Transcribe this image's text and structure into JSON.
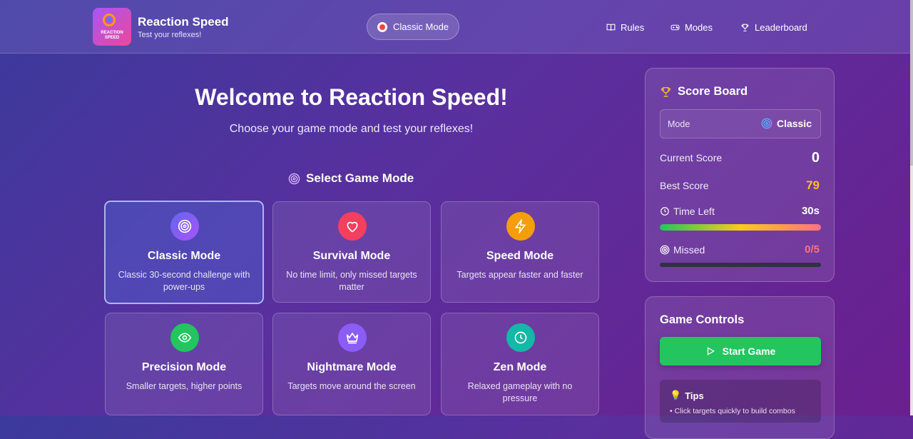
{
  "header": {
    "logo_text_line1": "REACTION",
    "logo_text_line2": "SPEED",
    "title": "Reaction Speed",
    "subtitle": "Test your reflexes!",
    "mode_pill": "Classic Mode",
    "nav": [
      {
        "label": "Rules",
        "icon": "book-icon"
      },
      {
        "label": "Modes",
        "icon": "gamepad-icon"
      },
      {
        "label": "Leaderboard",
        "icon": "trophy-icon"
      }
    ]
  },
  "main": {
    "welcome": "Welcome to Reaction Speed!",
    "subtitle": "Choose your game mode and test your reflexes!",
    "select_title": "Select Game Mode",
    "modes": [
      {
        "title": "Classic Mode",
        "desc": "Classic 30-second challenge with power-ups",
        "icon": "target-icon",
        "color": "#6366f1",
        "selected": true
      },
      {
        "title": "Survival Mode",
        "desc": "No time limit, only missed targets matter",
        "icon": "heart-icon",
        "color": "#f43f5e",
        "selected": false
      },
      {
        "title": "Speed Mode",
        "desc": "Targets appear faster and faster",
        "icon": "lightning-icon",
        "color": "#f59e0b",
        "selected": false
      },
      {
        "title": "Precision Mode",
        "desc": "Smaller targets, higher points",
        "icon": "eye-icon",
        "color": "#22c55e",
        "selected": false
      },
      {
        "title": "Nightmare Mode",
        "desc": "Targets move around the screen",
        "icon": "crown-icon",
        "color": "#8b5cf6",
        "selected": false
      },
      {
        "title": "Zen Mode",
        "desc": "Relaxed gameplay with no pressure",
        "icon": "clock-icon",
        "color": "#14b8a6",
        "selected": false
      }
    ]
  },
  "scoreboard": {
    "title": "Score Board",
    "mode_label": "Mode",
    "mode_value": "Classic",
    "current_score_label": "Current Score",
    "current_score": "0",
    "best_score_label": "Best Score",
    "best_score": "79",
    "time_left_label": "Time Left",
    "time_left": "30s",
    "time_fraction": 1.0,
    "missed_label": "Missed",
    "missed": "0/5",
    "missed_fraction": 0.0,
    "colors": {
      "best": "#fbbf24",
      "missed": "#fb7185",
      "trophy": "#fbbf24"
    }
  },
  "controls": {
    "title": "Game Controls",
    "start_label": "Start Game",
    "tips_title": "Tips",
    "tip_1": "• Click targets quickly to build combos"
  }
}
